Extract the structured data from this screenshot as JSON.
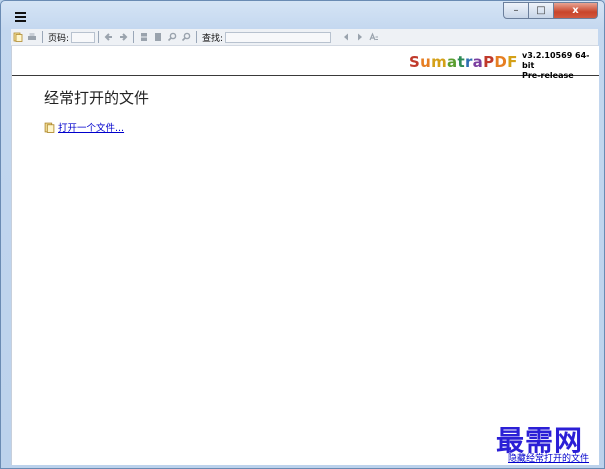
{
  "window": {
    "caption_buttons": {
      "minimize": "–",
      "maximize": "□",
      "close": "x"
    }
  },
  "toolbar": {
    "page_label": "页码:",
    "find_label": "查找:"
  },
  "header": {
    "brand_letters": [
      {
        "ch": "S",
        "color": "#c0392b"
      },
      {
        "ch": "u",
        "color": "#e67e22"
      },
      {
        "ch": "m",
        "color": "#d4a017"
      },
      {
        "ch": "a",
        "color": "#5a9e2f"
      },
      {
        "ch": "t",
        "color": "#2e8b57"
      },
      {
        "ch": "r",
        "color": "#2f6fb3"
      },
      {
        "ch": "a",
        "color": "#7b3fa0"
      },
      {
        "ch": "P",
        "color": "#c0392b"
      },
      {
        "ch": "D",
        "color": "#e67e22"
      },
      {
        "ch": "F",
        "color": "#d4a017"
      }
    ],
    "version_line1": "v3.2.10569 64-bit",
    "version_line2": "Pre-release"
  },
  "main": {
    "frequent_title": "经常打开的文件",
    "open_file_link": "打开一个文件...",
    "hide_link": "隐藏经常打开的文件"
  },
  "watermark": {
    "text": "最需网"
  }
}
